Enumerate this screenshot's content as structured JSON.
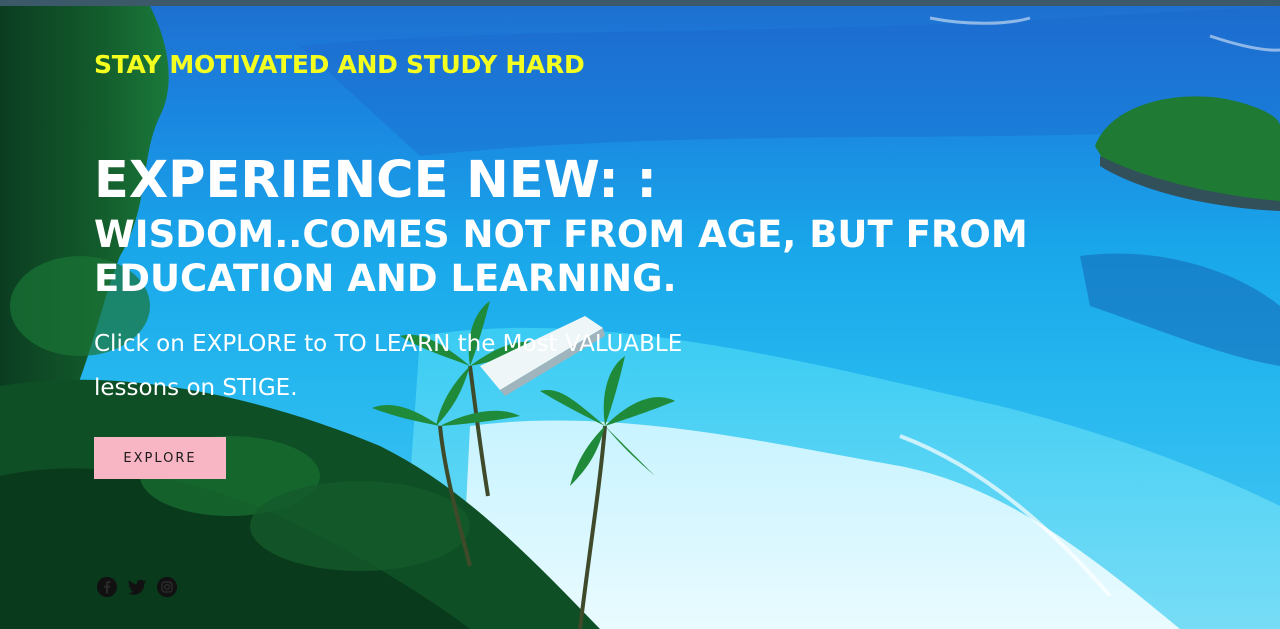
{
  "hero": {
    "tagline": "STAY MOTIVATED AND STUDY HARD",
    "headline": "EXPERIENCE NEW: :",
    "subheadline": "WISDOM..COMES NOT FROM AGE, BUT FROM EDUCATION AND LEARNING.",
    "intro": "Click on EXPLORE to TO LEARN the Most VALUABLE lessons on STIGE.",
    "explore_label": "EXPLORE"
  },
  "social": {
    "icons": [
      "facebook-icon",
      "twitter-icon",
      "instagram-icon"
    ]
  },
  "colors": {
    "tagline": "#f4ff1f",
    "button_bg": "#f8b6c4",
    "text": "#ffffff",
    "top_bar": "#3b5968"
  }
}
